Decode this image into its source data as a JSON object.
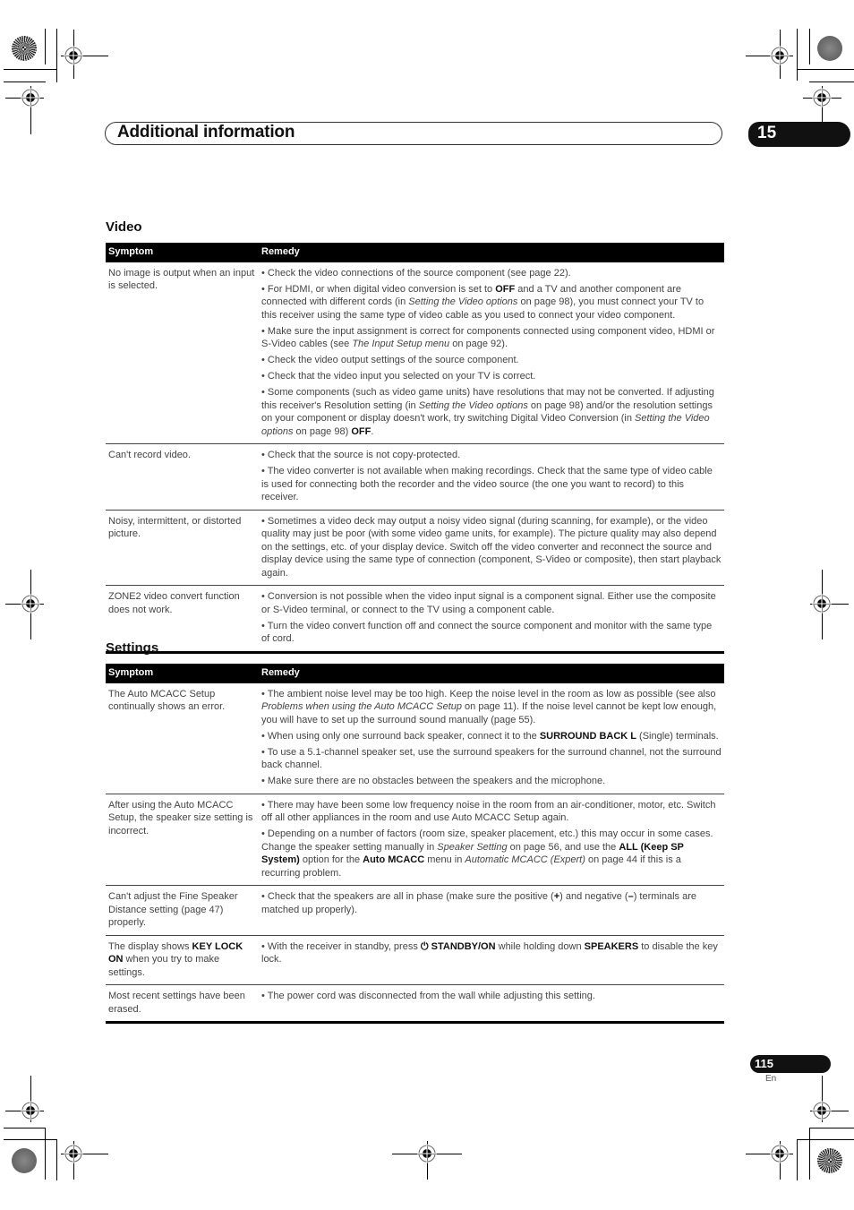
{
  "header": {
    "title": "Additional information",
    "chapter": "15"
  },
  "sections": {
    "video": {
      "title": "Video",
      "col_symptom": "Symptom",
      "col_remedy": "Remedy",
      "rows": [
        {
          "symptom": "No image is output when an input is selected.",
          "remedies": [
            [
              {
                "t": "• Check the video connections of the source component (see page 22)."
              }
            ],
            [
              {
                "t": "• For HDMI, or when digital video conversion is set to "
              },
              {
                "t": "OFF",
                "b": true
              },
              {
                "t": " and a TV and another component are connected with different cords (in "
              },
              {
                "t": "Setting the Video options",
                "i": true
              },
              {
                "t": " on page 98), you must connect your TV to this receiver using the same type of video cable as you used to connect your video component."
              }
            ],
            [
              {
                "t": "• Make sure the input assignment is correct for components connected using component video, HDMI or S-Video cables (see "
              },
              {
                "t": "The Input Setup menu",
                "i": true
              },
              {
                "t": " on page 92)."
              }
            ],
            [
              {
                "t": "• Check the video output settings of the source component."
              }
            ],
            [
              {
                "t": "• Check that the video input you selected on your TV is correct."
              }
            ],
            [
              {
                "t": "• Some components (such as video game units) have resolutions that may not be converted. If adjusting this receiver's Resolution setting (in "
              },
              {
                "t": "Setting the Video options",
                "i": true
              },
              {
                "t": " on page 98) and/or the resolution settings on your component or display doesn't work, try switching Digital Video Conversion (in "
              },
              {
                "t": "Setting the Video options",
                "i": true
              },
              {
                "t": " on page 98) "
              },
              {
                "t": "OFF",
                "b": true
              },
              {
                "t": "."
              }
            ]
          ]
        },
        {
          "symptom": "Can't record video.",
          "remedies": [
            [
              {
                "t": "• Check that the source is not copy-protected."
              }
            ],
            [
              {
                "t": "• The video converter is not available when making recordings. Check that the same type of video cable is used for connecting both the recorder and the video source (the one you want to record) to this receiver."
              }
            ]
          ]
        },
        {
          "symptom": "Noisy, intermittent, or distorted picture.",
          "remedies": [
            [
              {
                "t": "• Sometimes a video deck may output a noisy video signal (during scanning, for example), or the video quality may just be poor (with some video game units, for example). The picture quality may also depend on the settings, etc. of your display device. Switch off the video converter and reconnect the source and display device using the same type of connection (component, S-Video or composite), then start playback again."
              }
            ]
          ]
        },
        {
          "symptom": "ZONE2 video convert function does not work.",
          "remedies": [
            [
              {
                "t": "• Conversion is not possible when the video input signal is a component signal. Either use the composite or S-Video terminal, or connect to the TV using a component cable."
              }
            ],
            [
              {
                "t": "• Turn the video convert function off and connect the source component and monitor with the same type of cord."
              }
            ]
          ]
        }
      ]
    },
    "settings": {
      "title": "Settings",
      "col_symptom": "Symptom",
      "col_remedy": "Remedy",
      "rows": [
        {
          "symptom": "The Auto MCACC Setup continually shows an error.",
          "remedies": [
            [
              {
                "t": "• The ambient noise level may be too high. Keep the noise level in the room as low as possible (see also "
              },
              {
                "t": "Problems when using the Auto MCACC Setup",
                "i": true
              },
              {
                "t": " on page 11). If the noise level cannot be kept low enough, you will have to set up the surround sound manually (page 55)."
              }
            ],
            [
              {
                "t": "• When using only one surround back speaker, connect it to the "
              },
              {
                "t": "SURROUND BACK L",
                "b": true
              },
              {
                "t": " (Single) terminals."
              }
            ],
            [
              {
                "t": "• To use a 5.1-channel speaker set, use the surround speakers for the surround channel, not the surround back channel."
              }
            ],
            [
              {
                "t": "• Make sure there are no obstacles between the speakers and the microphone."
              }
            ]
          ]
        },
        {
          "symptom": "After using the Auto MCACC Setup, the speaker size setting is incorrect.",
          "remedies": [
            [
              {
                "t": "• There may have been some low frequency noise in the room from an air-conditioner, motor, etc. Switch off all other appliances in the room and use Auto MCACC Setup again."
              }
            ],
            [
              {
                "t": "• Depending on a number of factors (room size, speaker placement, etc.) this may occur in some cases. Change the speaker setting manually in "
              },
              {
                "t": "Speaker Setting",
                "i": true
              },
              {
                "t": " on page 56, and use the "
              },
              {
                "t": "ALL (Keep SP System)",
                "b": true
              },
              {
                "t": " option for the "
              },
              {
                "t": "Auto MCACC",
                "b": true
              },
              {
                "t": " menu in "
              },
              {
                "t": "Automatic MCACC (Expert)",
                "i": true
              },
              {
                "t": " on page 44 if this is a recurring problem."
              }
            ]
          ]
        },
        {
          "symptom": "Can't adjust the Fine Speaker Distance setting (page 47) properly.",
          "remedies": [
            [
              {
                "t": "• Check that the speakers are all in phase (make sure the positive ("
              },
              {
                "t": "+",
                "b": true
              },
              {
                "t": ") and negative ("
              },
              {
                "t": "–",
                "b": true
              },
              {
                "t": ") terminals are matched up properly)."
              }
            ]
          ]
        },
        {
          "symptom_rich": [
            {
              "t": "The display shows "
            },
            {
              "t": "KEY LOCK ON",
              "b": true
            },
            {
              "t": " when you try to make settings."
            }
          ],
          "remedies": [
            [
              {
                "t": "• With the receiver in standby, press "
              },
              {
                "t": "⏻ STANDBY/ON",
                "b": true
              },
              {
                "t": " while holding down "
              },
              {
                "t": "SPEAKERS",
                "b": true
              },
              {
                "t": " to disable the key lock."
              }
            ]
          ]
        },
        {
          "symptom": "Most recent settings have been erased.",
          "remedies": [
            [
              {
                "t": "• The power cord was disconnected from the wall while adjusting this setting."
              }
            ]
          ]
        }
      ]
    }
  },
  "footer": {
    "page_number": "115",
    "language": "En"
  }
}
